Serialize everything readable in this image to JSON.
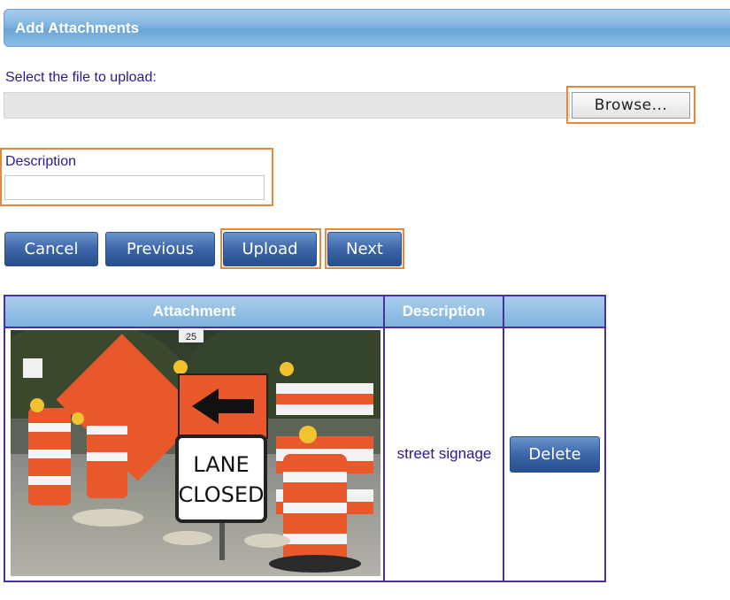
{
  "panel": {
    "title": "Add Attachments"
  },
  "upload": {
    "select_label": "Select the file to upload:",
    "file_value": "",
    "browse_label": "Browse..."
  },
  "description": {
    "label": "Description",
    "value": ""
  },
  "buttons": {
    "cancel": "Cancel",
    "previous": "Previous",
    "upload": "Upload",
    "next": "Next"
  },
  "grid": {
    "columns": [
      "Attachment",
      "Description",
      ""
    ],
    "rows": [
      {
        "attachment": "street-signage-photo",
        "sign_text": [
          "LANE",
          "CLOSED"
        ],
        "route_sign": "25",
        "description": "street signage",
        "delete_label": "Delete"
      }
    ]
  },
  "colors": {
    "highlight": "#e8873a",
    "button": "#3c66a8",
    "label_text": "#2b1a8c",
    "grid_border": "#4b2f9c"
  }
}
